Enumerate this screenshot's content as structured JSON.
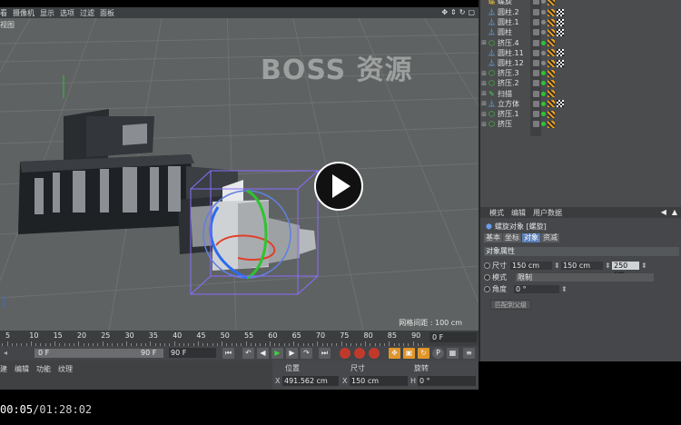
{
  "viewport": {
    "menu": [
      "看",
      "摄像机",
      "显示",
      "选项",
      "过滤",
      "面板"
    ],
    "view_name": "视图",
    "watermark": "BOSS 资源",
    "grid_spacing": "网格间距 : 100 cm",
    "nav_icons": [
      "move-icon",
      "zoom-icon",
      "rotate-icon",
      "maximize-icon"
    ]
  },
  "objects": [
    {
      "name": "螺旋",
      "icon": "spline"
    },
    {
      "name": "圆柱.2",
      "icon": "cylinder"
    },
    {
      "name": "圆柱.1",
      "icon": "cylinder"
    },
    {
      "name": "圆柱",
      "icon": "cylinder"
    },
    {
      "name": "挤压.4",
      "icon": "extrude"
    },
    {
      "name": "圆柱.11",
      "icon": "cylinder"
    },
    {
      "name": "圆柱.12",
      "icon": "cylinder"
    },
    {
      "name": "挤压.3",
      "icon": "extrude"
    },
    {
      "name": "挤压.2",
      "icon": "extrude"
    },
    {
      "name": "扫描",
      "icon": "sweep"
    },
    {
      "name": "立方体",
      "icon": "cube"
    },
    {
      "name": "挤压.1",
      "icon": "extrude"
    },
    {
      "name": "挤压",
      "icon": "extrude"
    }
  ],
  "attributes": {
    "menu": [
      "模式",
      "编辑",
      "用户数据"
    ],
    "object_title": "螺旋对象 [螺旋]",
    "tabs": [
      "基本",
      "坐标",
      "对象",
      "资减"
    ],
    "active_tab_index": 2,
    "section": "对象属性",
    "size_label": "尺寸",
    "size_values": [
      "150 cm",
      "150 cm",
      "250 cm"
    ],
    "mode_label": "模式",
    "mode_value": "限制",
    "angle_label": "角度",
    "angle_value": "0 °",
    "fit_button": "匹配到父级"
  },
  "timeline": {
    "ticks": [
      5,
      10,
      15,
      20,
      25,
      30,
      35,
      40,
      45,
      50,
      55,
      60,
      65,
      70,
      75,
      80,
      85,
      90
    ],
    "current_frame": "0 F"
  },
  "transport": {
    "range_start": "0 F",
    "range_end": "90 F",
    "end_frame": "90 F"
  },
  "material_menu": [
    "建",
    "编辑",
    "功能",
    "纹理"
  ],
  "coordinates": {
    "position_header": "位置",
    "size_header": "尺寸",
    "rotation_header": "旋转",
    "x_position": "491.562 cm",
    "x_size": "150 cm",
    "h_rotation": "0 °",
    "x_axis": "X",
    "h_axis": "H"
  },
  "player": {
    "current_time": "00:05",
    "total_time": "/01:28:02"
  },
  "colors": {
    "viewport_bg": "#5f6262",
    "selection_box": "#8a6cff",
    "spline_red": "#e0402a",
    "axis_green": "#2ec42e",
    "axis_blue": "#2a6cf0"
  }
}
